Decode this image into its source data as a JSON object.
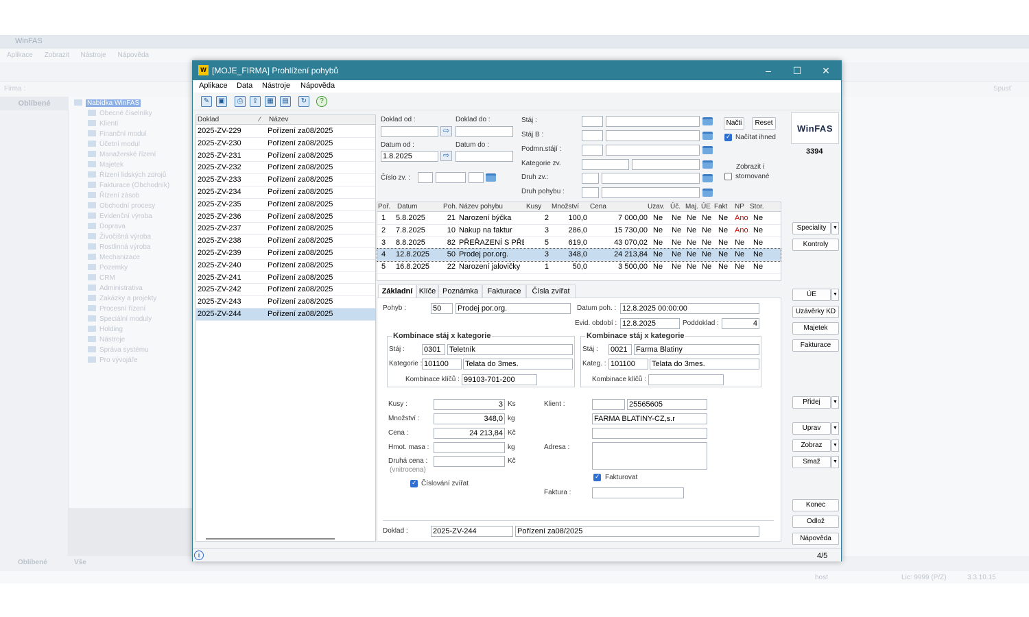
{
  "background": {
    "title": "WinFAS",
    "menu": [
      "Aplikace",
      "Zobrazit",
      "Nástroje",
      "Nápověda"
    ],
    "firma_label": "Firma :",
    "left_header": "Oblíbené",
    "tree_root": "Nabídka WinFAS",
    "tree": [
      "Obecné číselníky",
      "Klienti",
      "Finanční modul",
      "Účetní modul",
      "Manažerské řízení",
      "Majetek",
      "Řízení lidských zdrojů",
      "Fakturace (Obchodník)",
      "Řízení zásob",
      "Obchodní procesy",
      "Evidenční výroba",
      "Doprava",
      "Živočišná výroba",
      "Rostlinná výroba",
      "Mechanizace",
      "Pozemky",
      "CRM",
      "Administrativa",
      "Zakázky a projekty",
      "Procesní řízení",
      "Speciální moduly",
      "Holding",
      "Nástroje",
      "Správa systému",
      "Pro vývojáře"
    ],
    "bottom_tabs": [
      "Oblíbené",
      "Vše"
    ],
    "spust": "Spusť",
    "status_user": "host",
    "status_lic": "Lic: 9999 (P/Z)",
    "status_ver": "3.3.10.15"
  },
  "dialog": {
    "title": "[MOJE_FIRMA] Prohlížení pohybů",
    "menu": [
      "Aplikace",
      "Data",
      "Nástroje",
      "Nápověda"
    ],
    "list": {
      "col_doklad": "Doklad",
      "col_nazev": "Název",
      "rows": [
        {
          "doklad": "2025-ZV-229",
          "nazev": "Pořízení za08/2025"
        },
        {
          "doklad": "2025-ZV-230",
          "nazev": "Pořízení za08/2025"
        },
        {
          "doklad": "2025-ZV-231",
          "nazev": "Pořízení za08/2025"
        },
        {
          "doklad": "2025-ZV-232",
          "nazev": "Pořízení za08/2025"
        },
        {
          "doklad": "2025-ZV-233",
          "nazev": "Pořízení za08/2025"
        },
        {
          "doklad": "2025-ZV-234",
          "nazev": "Pořízení za08/2025"
        },
        {
          "doklad": "2025-ZV-235",
          "nazev": "Pořízení za08/2025"
        },
        {
          "doklad": "2025-ZV-236",
          "nazev": "Pořízení za08/2025"
        },
        {
          "doklad": "2025-ZV-237",
          "nazev": "Pořízení za08/2025"
        },
        {
          "doklad": "2025-ZV-238",
          "nazev": "Pořízení za08/2025"
        },
        {
          "doklad": "2025-ZV-239",
          "nazev": "Pořízení za08/2025"
        },
        {
          "doklad": "2025-ZV-240",
          "nazev": "Pořízení za08/2025"
        },
        {
          "doklad": "2025-ZV-241",
          "nazev": "Pořízení za08/2025"
        },
        {
          "doklad": "2025-ZV-242",
          "nazev": "Pořízení za08/2025"
        },
        {
          "doklad": "2025-ZV-243",
          "nazev": "Pořízení za08/2025"
        },
        {
          "doklad": "2025-ZV-244",
          "nazev": "Pořízení za08/2025"
        }
      ]
    },
    "filter": {
      "doklad_od": "Doklad od :",
      "doklad_do": "Doklad do :",
      "datum_od": "Datum od :",
      "datum_do": "Datum do :",
      "datum_od_value": "1.8.2025",
      "cislo_zv": "Číslo zv. :",
      "staj": "Stáj :",
      "staj_b": "Stáj B :",
      "podm_staji": "Podmn.stájí :",
      "kategorie_zv": "Kategorie zv.",
      "druh_zv": "Druh zv.:",
      "druh_pohybu": "Druh pohybu :",
      "nacti": "Načti",
      "reset": "Reset",
      "nacitat_ihned": "Načítat ihned",
      "zobrazit_i": "Zobrazit i",
      "stornovane": "stornované"
    },
    "grid": {
      "headers": [
        "Poř.",
        "Datum",
        "Poh.",
        "Název pohybu",
        "Kusy",
        "Množství",
        "Cena",
        "Uzav.",
        "Úč.",
        "Maj.",
        "ÚE",
        "Fakt",
        "NP",
        "Stor."
      ],
      "rows": [
        {
          "por": "1",
          "datum": "5.8.2025",
          "poh": "21",
          "nazev": "Narození býčka",
          "kusy": "2",
          "mnozstvi": "100,0",
          "cena": "7 000,00",
          "uzav": "Ne",
          "uc": "Ne",
          "maj": "Ne",
          "ue": "Ne",
          "fakt": "Ne",
          "np": "Ano",
          "stor": "Ne"
        },
        {
          "por": "2",
          "datum": "7.8.2025",
          "poh": "10",
          "nazev": "Nakup na faktur",
          "kusy": "3",
          "mnozstvi": "286,0",
          "cena": "15 730,00",
          "uzav": "Ne",
          "uc": "Ne",
          "maj": "Ne",
          "ue": "Ne",
          "fakt": "Ne",
          "np": "Ano",
          "stor": "Ne"
        },
        {
          "por": "3",
          "datum": "8.8.2025",
          "poh": "82",
          "nazev": "PŘEŘAZENÍ S PŘEVC",
          "kusy": "5",
          "mnozstvi": "619,0",
          "cena": "43 070,02",
          "uzav": "Ne",
          "uc": "Ne",
          "maj": "Ne",
          "ue": "Ne",
          "fakt": "Ne",
          "np": "Ne",
          "stor": "Ne"
        },
        {
          "por": "4",
          "datum": "12.8.2025",
          "poh": "50",
          "nazev": "Prodej por.org.",
          "kusy": "3",
          "mnozstvi": "348,0",
          "cena": "24 213,84",
          "uzav": "Ne",
          "uc": "Ne",
          "maj": "Ne",
          "ue": "Ne",
          "fakt": "Ne",
          "np": "Ne",
          "stor": "Ne"
        },
        {
          "por": "5",
          "datum": "16.8.2025",
          "poh": "22",
          "nazev": "Narození jalovičky",
          "kusy": "1",
          "mnozstvi": "50,0",
          "cena": "3 500,00",
          "uzav": "Ne",
          "uc": "Ne",
          "maj": "Ne",
          "ue": "Ne",
          "fakt": "Ne",
          "np": "Ne",
          "stor": "Ne"
        }
      ]
    },
    "tabs": [
      "Základní",
      "Klíče",
      "Poznámka",
      "Fakturace",
      "Čísla zvířat"
    ],
    "detail": {
      "pohyb_label": "Pohyb :",
      "pohyb_code": "50",
      "pohyb_name": "Prodej por.org.",
      "datum_poh_label": "Datum poh. :",
      "datum_poh": "12.8.2025 00:00:00",
      "evid_obdobi_label": "Evid. období :",
      "evid_obdobi": "12.8.2025",
      "poddoklad_label": "Poddoklad :",
      "poddoklad": "4",
      "grp1_title": "Kombinace stáj x kategorie",
      "g1_staj_label": "Stáj :",
      "g1_staj_code": "0301",
      "g1_staj_name": "Teletník",
      "g1_kat_label": "Kategorie :",
      "g1_kat_code": "101100",
      "g1_kat_name": "Telata do 3mes.",
      "g1_komb_label": "Kombinace klíčů :",
      "g1_komb": "99103-701-200",
      "grp2_title": "Kombinace stáj x kategorie",
      "g2_staj_label": "Stáj :",
      "g2_staj_code": "0021",
      "g2_staj_name": "Farma Blatiny",
      "g2_kat_label": "Kateg. :",
      "g2_kat_code": "101100",
      "g2_kat_name": "Telata do 3mes.",
      "g2_komb_label": "Kombinace klíčů :",
      "g2_komb": "",
      "kusy_label": "Kusy :",
      "kusy": "3",
      "kusy_unit": "Ks",
      "mnozstvi_label": "Množství :",
      "mnozstvi": "348,0",
      "mnozstvi_unit": "kg",
      "cena_label": "Cena :",
      "cena": "24 213,84",
      "cena_unit": "Kč",
      "hmot_label": "Hmot. masa :",
      "hmot_unit": "kg",
      "druha_cena_label": "Druhá cena :",
      "druha_cena_unit": "Kč",
      "vnitrocena": "(vnitrocena)",
      "cislovani": "Číslování zvířat",
      "klient_label": "Klient :",
      "klient_code": "25565605",
      "klient_name": "FARMA BLATINY-CZ,s.r",
      "adresa_label": "Adresa :",
      "fakturovat": "Fakturovat",
      "faktura_label": "Faktura :",
      "doklad_label": "Doklad :",
      "doklad": "2025-ZV-244",
      "doklad_name": "Pořízení za08/2025"
    },
    "right": {
      "logo": "WinFAS",
      "number": "3394",
      "speciality": "Speciality",
      "kontroly": "Kontroly",
      "ue": "ÚE",
      "uzaverky": "Uzávěrky KD",
      "majetek": "Majetek",
      "fakturace": "Fakturace",
      "pridej": "Přidej",
      "uprav": "Uprav",
      "zobraz": "Zobraz",
      "smaz": "Smaž",
      "konec": "Konec",
      "odloz": "Odlož",
      "napoveda": "Nápověda"
    },
    "status_count": "4/5"
  },
  "colors": {
    "titlebar": "#2e7e96",
    "selection": "#c8dcf0",
    "accent": "#2f6fd1",
    "ano": "#d00000"
  }
}
